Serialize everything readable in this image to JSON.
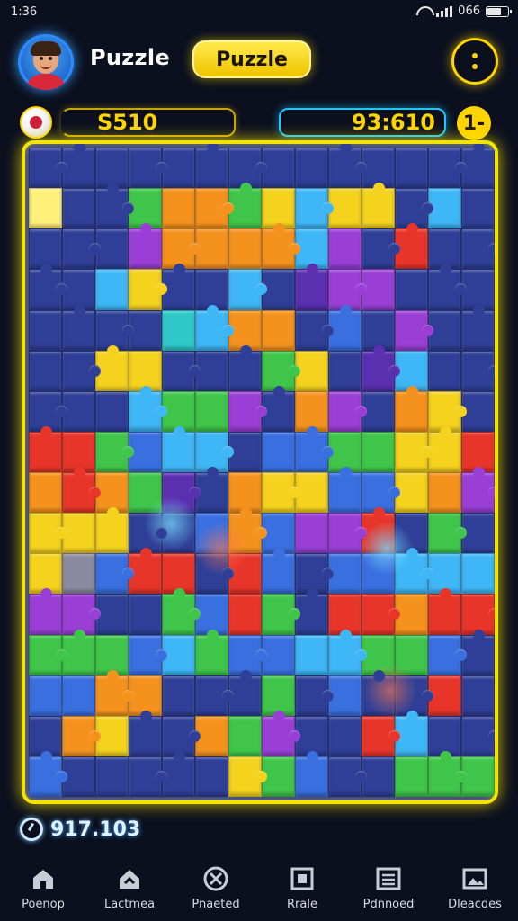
{
  "status_bar": {
    "time": "1:36",
    "battery": "066"
  },
  "header": {
    "app_title": "Puzzle",
    "title_pill": "Puzzle",
    "menu_icon": "more-vertical-icon"
  },
  "scores": {
    "left_value": "S510",
    "right_value": "93:610",
    "right_button": "1-"
  },
  "timer": {
    "value": "917.103"
  },
  "nav": [
    {
      "label": "Poenop",
      "icon": "home-icon"
    },
    {
      "label": "Lactmea",
      "icon": "house-arrow-icon"
    },
    {
      "label": "Pnaeted",
      "icon": "target-icon"
    },
    {
      "label": "Rrale",
      "icon": "frame-icon"
    },
    {
      "label": "Pdnnoed",
      "icon": "list-icon"
    },
    {
      "label": "Dleacdes",
      "icon": "image-icon"
    }
  ],
  "palette": {
    "bg": "#2f3f98",
    "blue": "#3a6fe0",
    "lightblue": "#3fb6f5",
    "green": "#3fc64a",
    "yellow": "#f4d21e",
    "orange": "#f5921e",
    "red": "#e8352a",
    "purple": "#9a3fd6",
    "darkpurple": "#5a2fb0",
    "teal": "#2ec8c8",
    "lightyellow": "#fff07a",
    "accent": "#f4e200",
    "gray": "#8a8aa0"
  },
  "board": {
    "rows": [
      [
        "bg",
        "bg",
        "bg",
        "bg",
        "bg",
        "bg",
        "bg",
        "bg",
        "bg",
        "bg",
        "bg",
        "bg",
        "bg",
        "bg"
      ],
      [
        "lightyellow",
        "bg",
        "bg",
        "green",
        "orange",
        "orange",
        "green",
        "yellow",
        "lightblue",
        "yellow",
        "yellow",
        "bg",
        "lightblue",
        "bg"
      ],
      [
        "bg",
        "bg",
        "bg",
        "purple",
        "orange",
        "orange",
        "orange",
        "orange",
        "lightblue",
        "purple",
        "bg",
        "red",
        "bg",
        "bg"
      ],
      [
        "bg",
        "bg",
        "lightblue",
        "yellow",
        "bg",
        "bg",
        "lightblue",
        "bg",
        "darkpurple",
        "purple",
        "purple",
        "bg",
        "bg",
        "bg"
      ],
      [
        "bg",
        "bg",
        "bg",
        "bg",
        "teal",
        "lightblue",
        "orange",
        "orange",
        "bg",
        "blue",
        "bg",
        "purple",
        "bg",
        "bg"
      ],
      [
        "bg",
        "bg",
        "yellow",
        "yellow",
        "bg",
        "bg",
        "bg",
        "green",
        "yellow",
        "bg",
        "darkpurple",
        "lightblue",
        "bg",
        "bg"
      ],
      [
        "bg",
        "bg",
        "bg",
        "lightblue",
        "green",
        "green",
        "purple",
        "bg",
        "orange",
        "purple",
        "bg",
        "orange",
        "yellow",
        "bg"
      ],
      [
        "red",
        "red",
        "green",
        "blue",
        "lightblue",
        "lightblue",
        "bg",
        "blue",
        "blue",
        "green",
        "green",
        "yellow",
        "yellow",
        "red"
      ],
      [
        "orange",
        "red",
        "orange",
        "green",
        "darkpurple",
        "bg",
        "orange",
        "yellow",
        "yellow",
        "blue",
        "blue",
        "yellow",
        "orange",
        "purple"
      ],
      [
        "yellow",
        "yellow",
        "yellow",
        "bg",
        "bg",
        "blue",
        "orange",
        "blue",
        "purple",
        "purple",
        "red",
        "bg",
        "green",
        "bg"
      ],
      [
        "yellow",
        "gray",
        "blue",
        "red",
        "red",
        "bg",
        "red",
        "blue",
        "bg",
        "blue",
        "blue",
        "lightblue",
        "lightblue",
        "lightblue"
      ],
      [
        "purple",
        "purple",
        "bg",
        "bg",
        "green",
        "blue",
        "red",
        "green",
        "bg",
        "red",
        "red",
        "orange",
        "red",
        "red"
      ],
      [
        "green",
        "green",
        "green",
        "blue",
        "lightblue",
        "green",
        "blue",
        "blue",
        "lightblue",
        "lightblue",
        "green",
        "green",
        "blue",
        "bg"
      ],
      [
        "blue",
        "blue",
        "orange",
        "orange",
        "bg",
        "bg",
        "bg",
        "green",
        "bg",
        "blue",
        "bg",
        "bg",
        "red",
        "bg"
      ],
      [
        "bg",
        "orange",
        "yellow",
        "bg",
        "bg",
        "orange",
        "green",
        "purple",
        "bg",
        "bg",
        "red",
        "lightblue",
        "bg",
        "bg"
      ],
      [
        "blue",
        "bg",
        "bg",
        "bg",
        "bg",
        "bg",
        "yellow",
        "green",
        "blue",
        "bg",
        "bg",
        "green",
        "green",
        "green"
      ]
    ]
  }
}
